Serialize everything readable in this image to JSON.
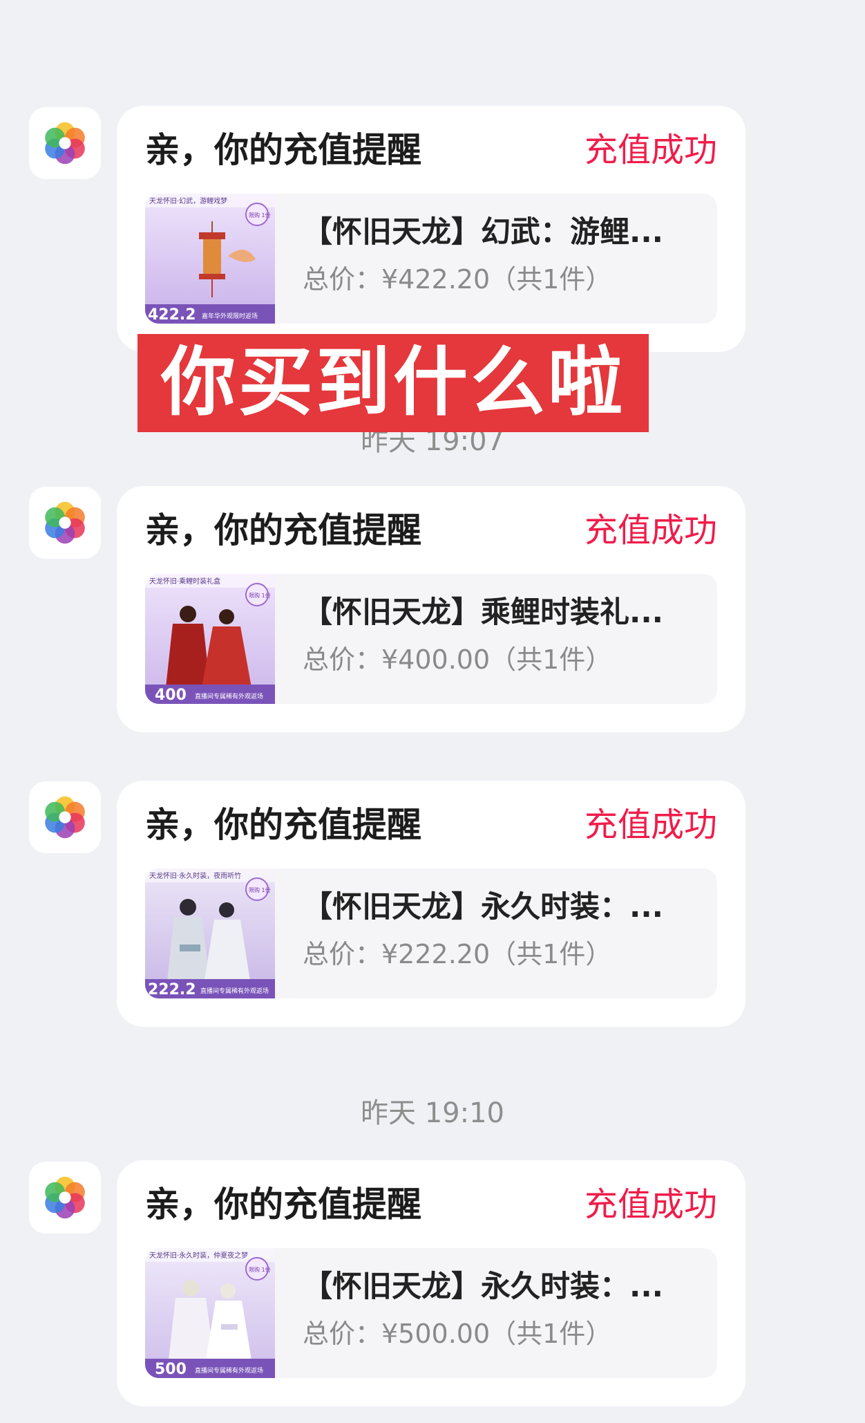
{
  "messages": [
    {
      "title": "亲，你的充值提醒",
      "status": "充值成功",
      "product_name": "【怀旧天龙】幻武：游鲤...",
      "price": "总价：¥422.20（共1件）",
      "thumb": {
        "top_text": "天龙怀旧·幻武，游鲤戏梦",
        "badge": "限购 1份",
        "price_text": "422.2",
        "bottom_text": "嘉年华外观限时返场"
      }
    },
    {
      "title": "亲，你的充值提醒",
      "status": "充值成功",
      "product_name": "【怀旧天龙】乘鲤时装礼...",
      "price": "总价：¥400.00（共1件）",
      "thumb": {
        "top_text": "天龙怀旧·乘鲤时装礼盒",
        "badge": "限购 1份",
        "price_text": "400",
        "bottom_text": "直播间专属稀有外观返场"
      }
    },
    {
      "title": "亲，你的充值提醒",
      "status": "充值成功",
      "product_name": "【怀旧天龙】永久时装：...",
      "price": "总价：¥222.20（共1件）",
      "thumb": {
        "top_text": "天龙怀旧·永久时装，夜雨听竹",
        "badge": "限购 1份",
        "price_text": "222.2",
        "bottom_text": "直播间专属稀有外观返场"
      }
    },
    {
      "title": "亲，你的充值提醒",
      "status": "充值成功",
      "product_name": "【怀旧天龙】永久时装：...",
      "price": "总价：¥500.00（共1件）",
      "thumb": {
        "top_text": "天龙怀旧·永久时装，仲夏夜之梦",
        "badge": "限购 1份",
        "price_text": "500",
        "bottom_text": "直播间专属稀有外观返场"
      }
    }
  ],
  "timestamps": [
    "昨天 19:07",
    "昨天 19:10"
  ],
  "overlay": {
    "text": "你买到什么啦"
  },
  "app_icon": "taobao-flower-icon",
  "colors": {
    "background": "#f0f1f5",
    "status": "#f01c4a",
    "overlay": "#e4383c",
    "thumb_purple": "#7a53b8"
  }
}
